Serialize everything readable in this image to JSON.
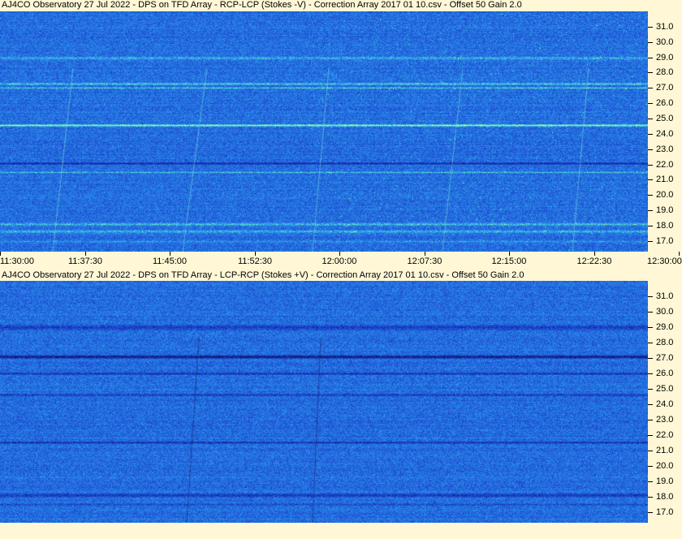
{
  "panels": [
    {
      "title": "AJ4CO Observatory 27 Jul 2022  -  DPS on TFD Array  -  RCP-LCP (Stokes -V)  -  Correction Array 2017 01 10.csv  -  Offset 50  Gain 2.0",
      "polarity": "RCP-LCP"
    },
    {
      "title": "AJ4CO Observatory 27 Jul 2022  -  DPS on TFD Array  -  LCP-RCP (Stokes +V)  -  Correction Array 2017 01 10.csv  -  Offset 50  Gain 2.0",
      "polarity": "LCP-RCP"
    }
  ],
  "colors": {
    "background": "#fff7d6",
    "spectrum_base": "#1c46d8"
  },
  "chart_data": {
    "type": "heatmap",
    "y_ticks": [
      "31.0",
      "30.0",
      "29.0",
      "28.0",
      "27.0",
      "26.0",
      "25.0",
      "24.0",
      "23.0",
      "22.0",
      "21.0",
      "20.0",
      "19.0",
      "18.0",
      "17.0"
    ],
    "y_values": [
      31,
      30,
      29,
      28,
      27,
      26,
      25,
      24,
      23,
      22,
      21,
      20,
      19,
      18,
      17
    ],
    "ylim": [
      16.3,
      32.0
    ],
    "x_ticks": [
      "11:30:00",
      "11:37:30",
      "11:45:00",
      "11:52:30",
      "12:00:00",
      "12:07:30",
      "12:15:00",
      "12:22:30",
      "12:30:00"
    ],
    "xlim": [
      "11:30:00",
      "12:30:00"
    ]
  }
}
